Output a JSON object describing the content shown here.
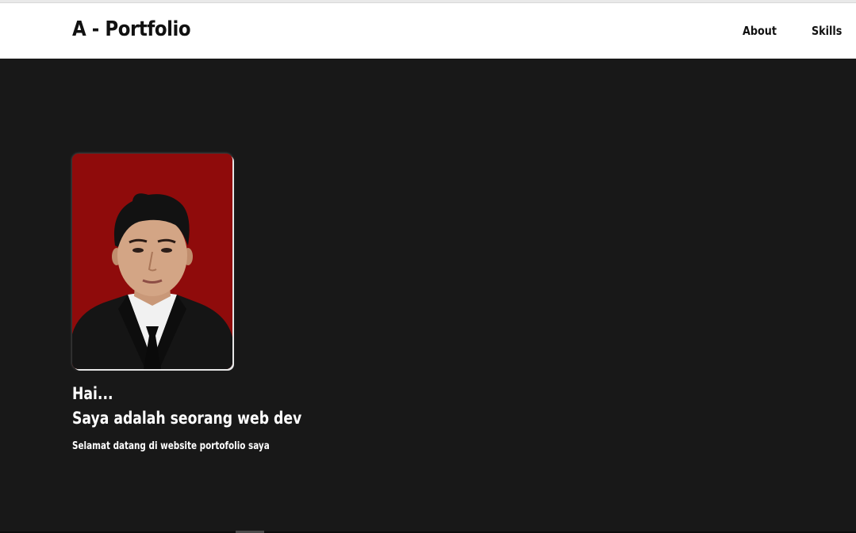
{
  "navbar": {
    "brand": "A - Portfolio",
    "links": [
      {
        "label": "About"
      },
      {
        "label": "Skills"
      }
    ]
  },
  "hero": {
    "greeting": "Hai...",
    "headline": "Saya adalah seorang web dev",
    "subtext": "Selamat datang di website portofolio saya",
    "photo": {
      "icon": "profile-photo",
      "background_color": "#8f0b0b"
    }
  },
  "colors": {
    "hero_background": "#181818",
    "navbar_background": "#ffffff",
    "text_on_dark": "#ffffff",
    "text_on_light": "#111111"
  }
}
